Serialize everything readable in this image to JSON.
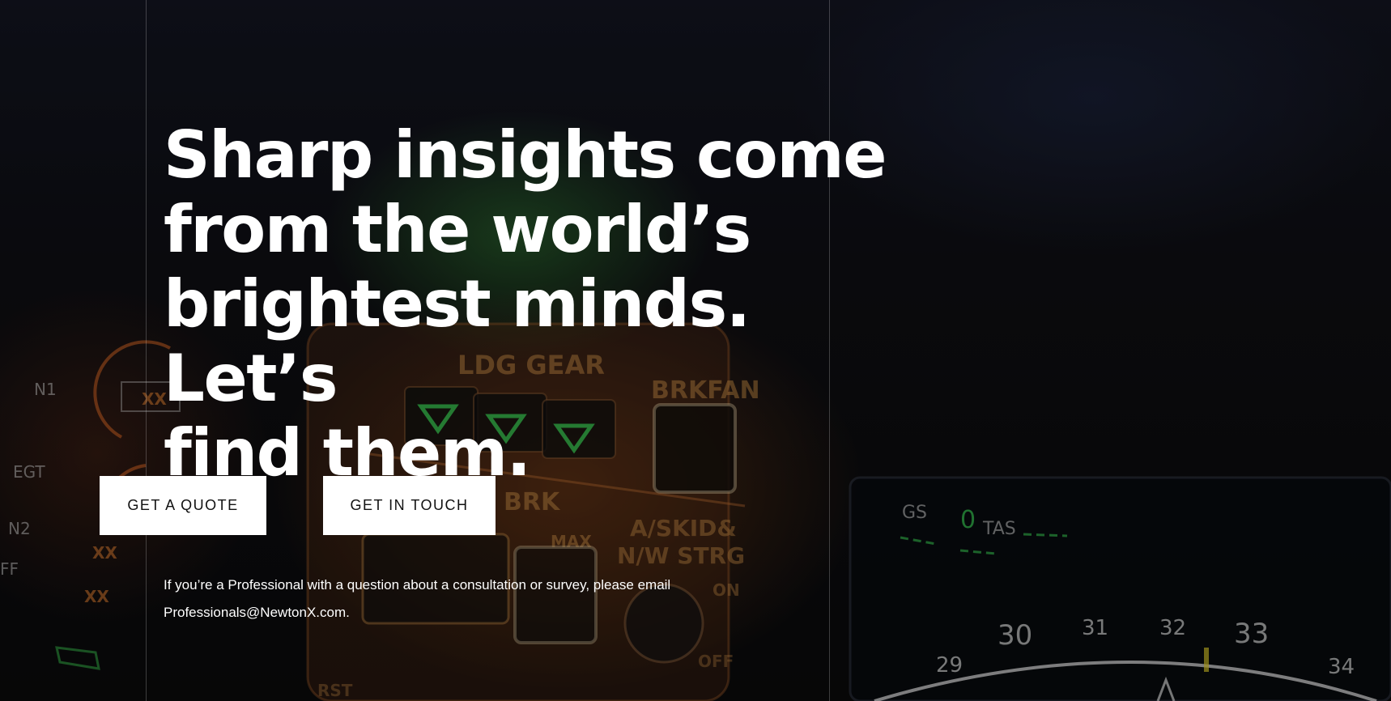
{
  "hero": {
    "headline_lines": [
      "Sharp insights come",
      "from the world’s",
      "brightest minds. Let’s",
      "find them."
    ],
    "quote_button": "GET A QUOTE",
    "touch_button": "GET IN TOUCH",
    "note_text": "If you’re a Professional with a question about a consultation or survey, please email",
    "note_email": "Professionals@NewtonX.com."
  },
  "background": {
    "panel_labels": [
      "LDG GEAR",
      "BRKFAN",
      "BRK",
      "MAX",
      "A/SKID&",
      "N/W STRG",
      "ON",
      "OFF",
      "RST",
      "N1",
      "EGT",
      "N2",
      "FF",
      "XX",
      "GS",
      "0",
      "TAS",
      "29",
      "30",
      "31",
      "32",
      "33",
      "34"
    ]
  },
  "colors": {
    "text": "#ffffff",
    "button_bg": "#ffffff",
    "button_text": "#111111",
    "display_green": "#3ddc5a",
    "amber": "#d9822b"
  }
}
